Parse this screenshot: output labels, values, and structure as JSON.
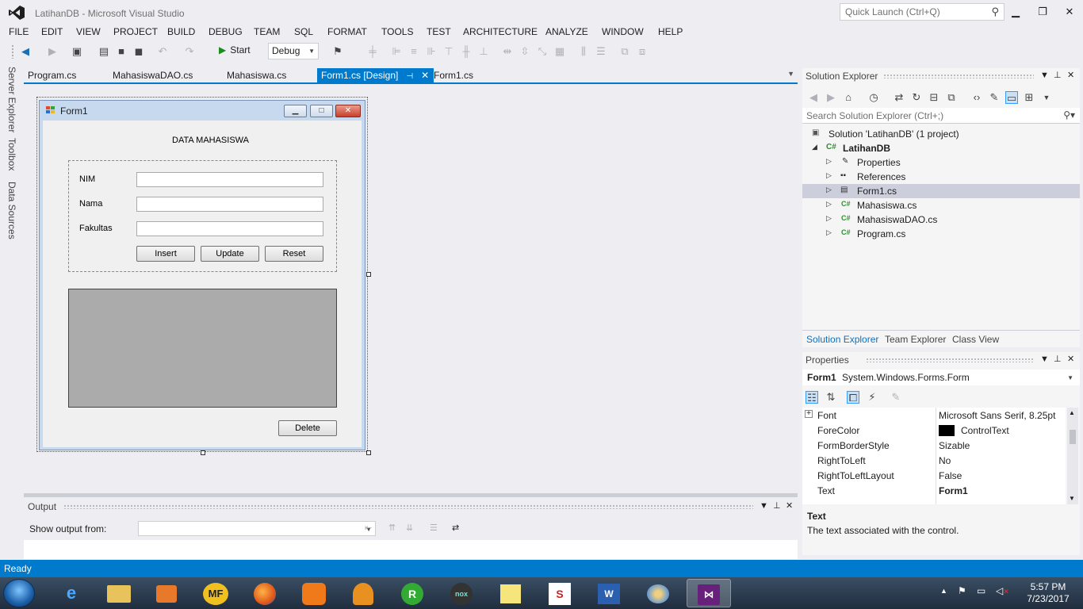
{
  "window": {
    "title": "LatihanDB - Microsoft Visual Studio",
    "quick_launch_placeholder": "Quick Launch (Ctrl+Q)"
  },
  "menu": [
    "FILE",
    "EDIT",
    "VIEW",
    "PROJECT",
    "BUILD",
    "DEBUG",
    "TEAM",
    "SQL",
    "FORMAT",
    "TOOLS",
    "TEST",
    "ARCHITECTURE",
    "ANALYZE",
    "WINDOW",
    "HELP"
  ],
  "toolbar": {
    "start_label": "Start",
    "config": "Debug"
  },
  "side_tabs": [
    "Server Explorer",
    "Toolbox",
    "Data Sources"
  ],
  "doc_tabs": [
    "Program.cs",
    "MahasiswaDAO.cs",
    "Mahasiswa.cs",
    "Form1.cs [Design]",
    "Form1.cs"
  ],
  "form": {
    "title": "Form1",
    "heading": "DATA MAHASISWA",
    "labels": [
      "NIM",
      "Nama",
      "Fakultas"
    ],
    "buttons": [
      "Insert",
      "Update",
      "Reset"
    ],
    "delete_label": "Delete"
  },
  "output": {
    "title": "Output",
    "show_from_label": "Show output from:"
  },
  "solution_explorer": {
    "title": "Solution Explorer",
    "search_placeholder": "Search Solution Explorer (Ctrl+;)",
    "tree": [
      {
        "label": "Solution 'LatihanDB' (1 project)",
        "icon": "solution-icon"
      },
      {
        "label": "LatihanDB",
        "icon": "csharp-project-icon"
      },
      {
        "label": "Properties",
        "icon": "wrench-icon"
      },
      {
        "label": "References",
        "icon": "references-icon"
      },
      {
        "label": "Form1.cs",
        "icon": "form-icon"
      },
      {
        "label": "Mahasiswa.cs",
        "icon": "csharp-file-icon"
      },
      {
        "label": "MahasiswaDAO.cs",
        "icon": "csharp-file-icon"
      },
      {
        "label": "Program.cs",
        "icon": "csharp-file-icon"
      }
    ],
    "tabs": [
      "Solution Explorer",
      "Team Explorer",
      "Class View"
    ]
  },
  "properties": {
    "title": "Properties",
    "object_name": "Form1",
    "object_type": "System.Windows.Forms.Form",
    "rows": [
      {
        "name": "Font",
        "value": "Microsoft Sans Serif, 8.25pt"
      },
      {
        "name": "ForeColor",
        "value": "ControlText"
      },
      {
        "name": "FormBorderStyle",
        "value": "Sizable"
      },
      {
        "name": "RightToLeft",
        "value": "No"
      },
      {
        "name": "RightToLeftLayout",
        "value": "False"
      },
      {
        "name": "Text",
        "value": "Form1"
      }
    ],
    "desc_title": "Text",
    "desc_text": "The text associated with the control."
  },
  "status": "Ready",
  "clock": {
    "time": "5:57 PM",
    "date": "7/23/2017"
  },
  "colors": {
    "accent": "#007acc",
    "forecolor_swatch": "#000000"
  }
}
